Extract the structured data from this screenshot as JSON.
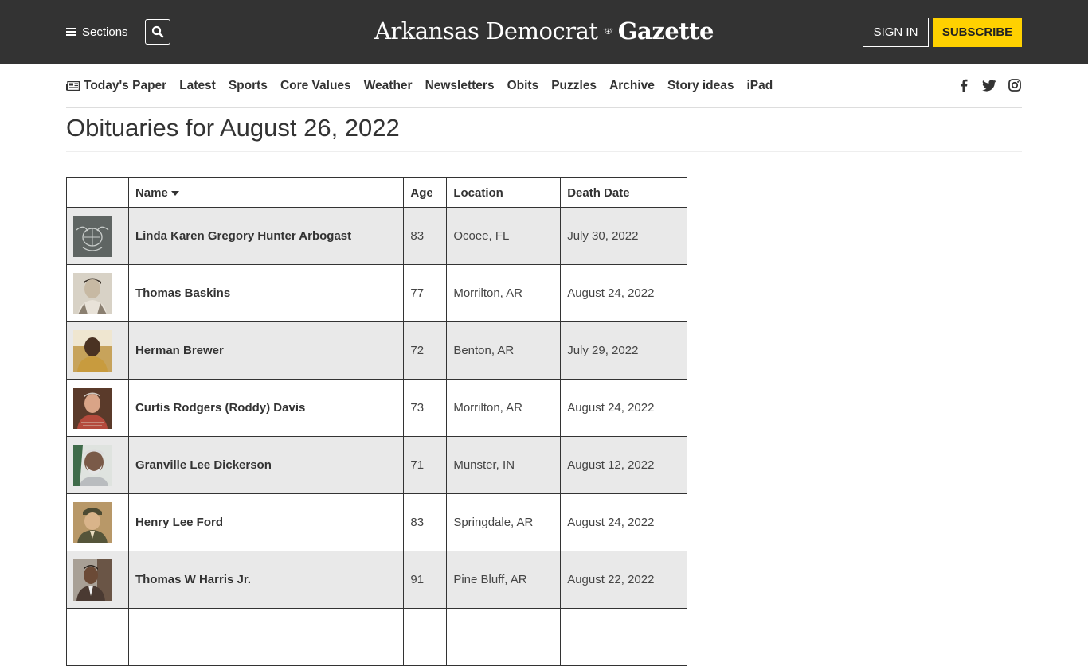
{
  "header": {
    "sections_label": "Sections",
    "masthead_left": "Arkansas Democrat",
    "masthead_right": "Gazette",
    "signin_label": "SIGN IN",
    "subscribe_label": "SUBSCRIBE",
    "bg_color": "#333333",
    "subscribe_color": "#ffd100"
  },
  "nav": {
    "items": [
      "Today's Paper",
      "Latest",
      "Sports",
      "Core Values",
      "Weather",
      "Newsletters",
      "Obits",
      "Puzzles",
      "Archive",
      "Story ideas",
      "iPad"
    ],
    "social": [
      "facebook-icon",
      "twitter-icon",
      "instagram-icon"
    ]
  },
  "page": {
    "title": "Obituaries for August 26, 2022"
  },
  "table": {
    "headers": {
      "photo": "",
      "name": "Name",
      "age": "Age",
      "location": "Location",
      "death_date": "Death Date"
    },
    "rows": [
      {
        "name": "Linda Karen Gregory Hunter Arbogast",
        "age": "83",
        "location": "Ocoee, FL",
        "death_date": "July 30, 2022",
        "photo": "seal-placeholder"
      },
      {
        "name": "Thomas Baskins",
        "age": "77",
        "location": "Morrilton, AR",
        "death_date": "August 24, 2022",
        "photo": "portrait"
      },
      {
        "name": "Herman Brewer",
        "age": "72",
        "location": "Benton, AR",
        "death_date": "July 29, 2022",
        "photo": "portrait"
      },
      {
        "name": "Curtis Rodgers (Roddy) Davis",
        "age": "73",
        "location": "Morrilton, AR",
        "death_date": "August 24, 2022",
        "photo": "portrait"
      },
      {
        "name": "Granville Lee Dickerson",
        "age": "71",
        "location": "Munster, IN",
        "death_date": "August 12, 2022",
        "photo": "portrait"
      },
      {
        "name": "Henry Lee Ford",
        "age": "83",
        "location": "Springdale, AR",
        "death_date": "August 24, 2022",
        "photo": "portrait"
      },
      {
        "name": "Thomas W Harris Jr.",
        "age": "91",
        "location": "Pine Bluff, AR",
        "death_date": "August 22, 2022",
        "photo": "portrait"
      }
    ]
  }
}
